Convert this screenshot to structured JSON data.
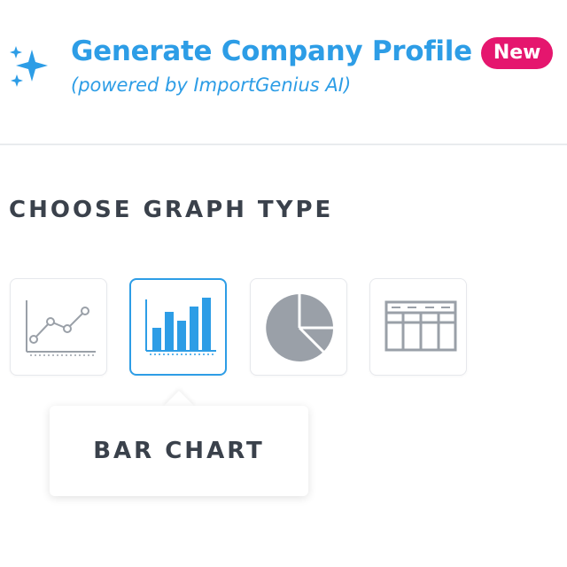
{
  "header": {
    "icon": "sparkle-icon",
    "title": "Generate Company Profile",
    "badge": "New",
    "subtitle": "(powered by ImportGenius AI)"
  },
  "section": {
    "heading": "CHOOSE GRAPH TYPE"
  },
  "graph_types": [
    {
      "icon": "line-chart-icon",
      "selected": false
    },
    {
      "icon": "bar-chart-icon",
      "selected": true
    },
    {
      "icon": "pie-chart-icon",
      "selected": false
    },
    {
      "icon": "table-icon",
      "selected": false
    }
  ],
  "tooltip": {
    "text": "BAR CHART"
  },
  "colors": {
    "accent": "#2d9de6",
    "badge": "#e5166e",
    "heading_text": "#3a414b",
    "icon_gray": "#9aa0a8",
    "divider": "#e9ebee"
  }
}
